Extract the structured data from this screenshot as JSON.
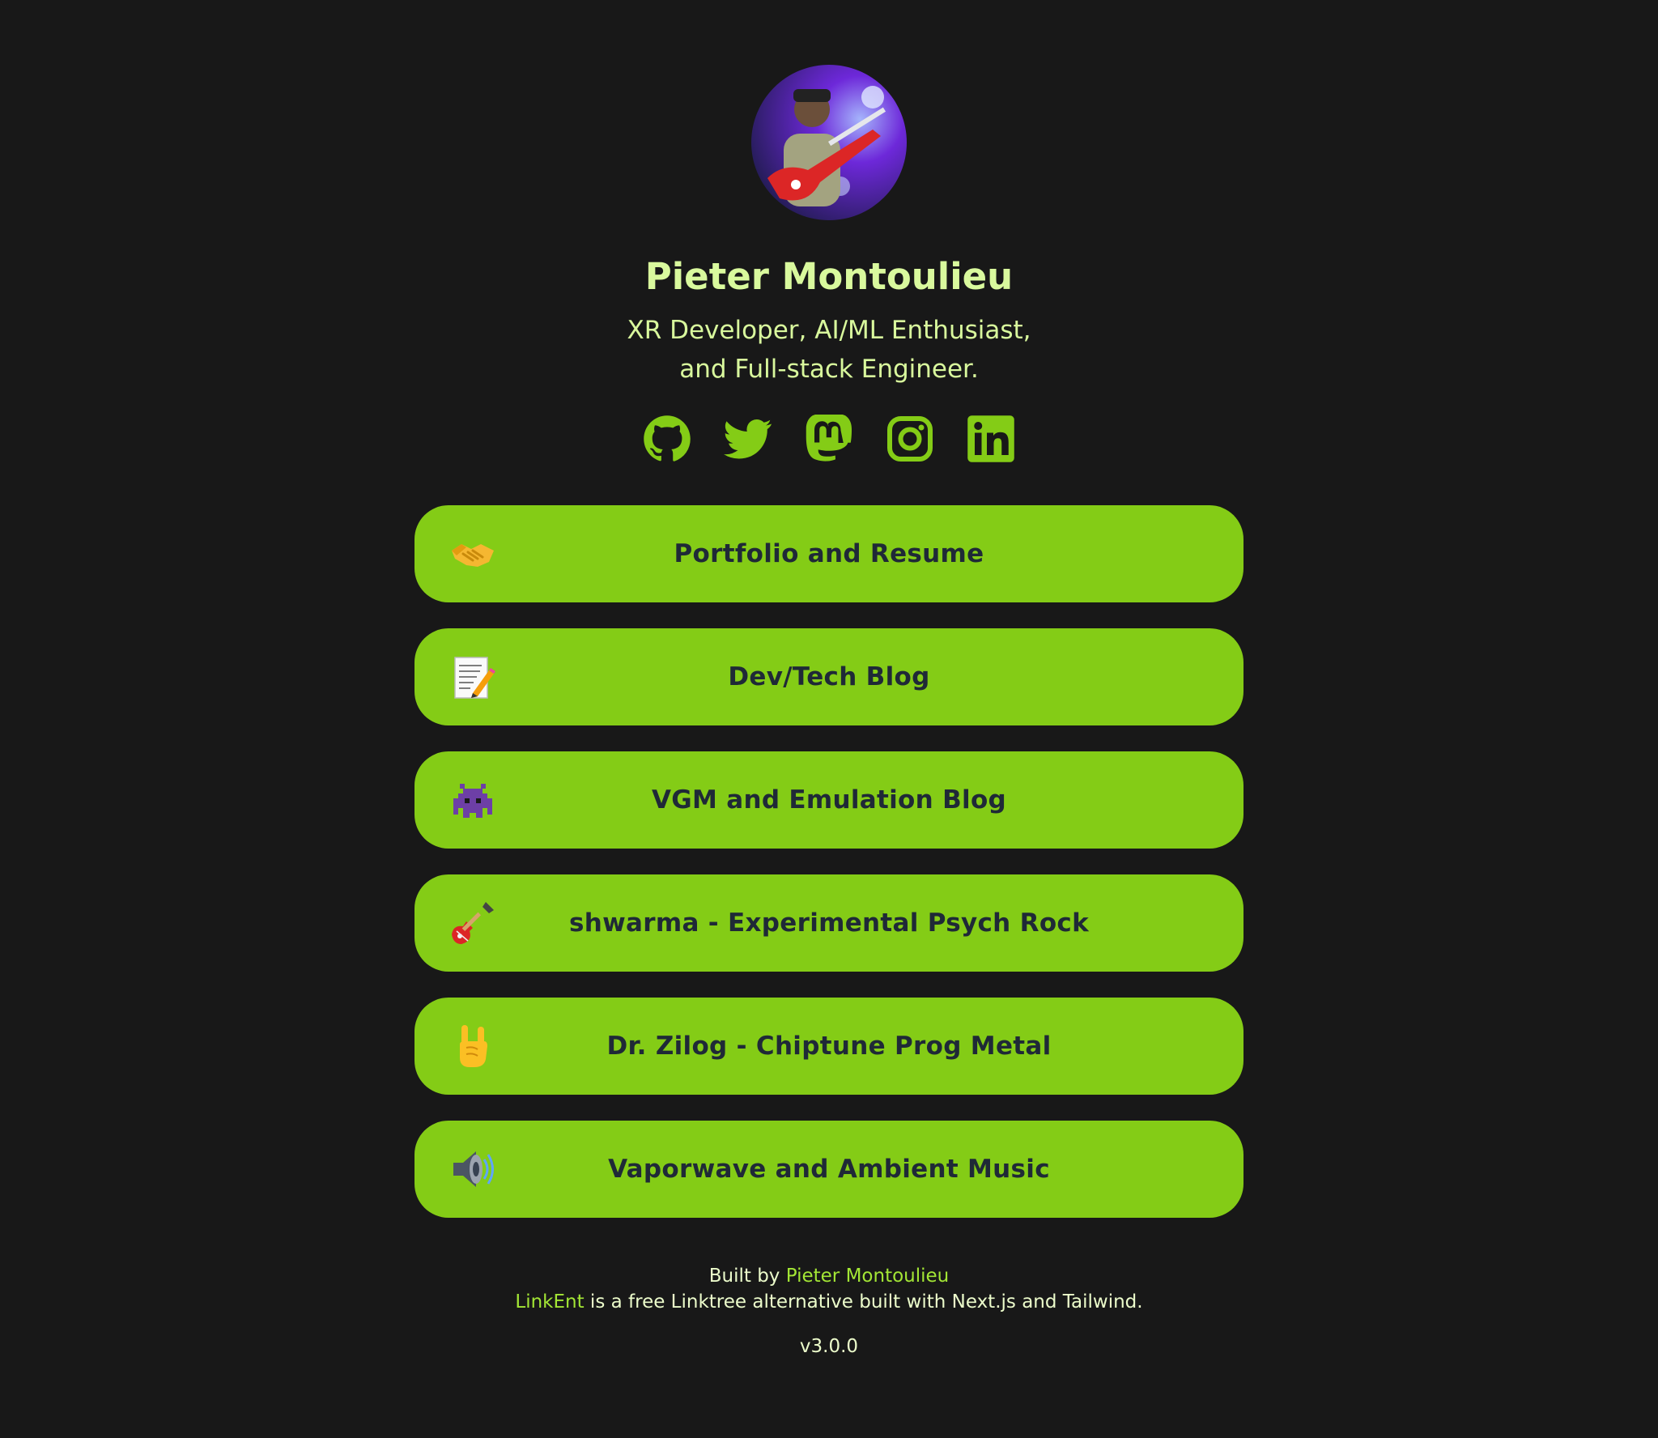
{
  "profile": {
    "name": "Pieter Montoulieu",
    "bio_line1": "XR Developer, AI/ML Enthusiast,",
    "bio_line2": "and Full-stack Engineer.",
    "avatar": "guitarist-on-stage-photo"
  },
  "socials": [
    {
      "icon": "github-icon"
    },
    {
      "icon": "twitter-icon"
    },
    {
      "icon": "mastodon-icon"
    },
    {
      "icon": "instagram-icon"
    },
    {
      "icon": "linkedin-icon"
    }
  ],
  "links": [
    {
      "label": "Portfolio and Resume",
      "icon": "handshake-emoji"
    },
    {
      "label": "Dev/Tech Blog",
      "icon": "memo-emoji"
    },
    {
      "label": "VGM and Emulation Blog",
      "icon": "space-invader-emoji"
    },
    {
      "label": "shwarma - Experimental Psych Rock",
      "icon": "guitar-emoji"
    },
    {
      "label": "Dr. Zilog - Chiptune Prog Metal",
      "icon": "rock-hand-emoji"
    },
    {
      "label": "Vaporwave and Ambient Music",
      "icon": "speaker-emoji"
    }
  ],
  "footer": {
    "built_by_prefix": "Built by ",
    "built_by_link": "Pieter Montoulieu",
    "linkent_link": "LinkEnt",
    "linkent_text": " is a free Linktree alternative built with Next.js and Tailwind.",
    "version": "v3.0.0"
  },
  "colors": {
    "background": "#181818",
    "accent": "#84cc16",
    "text": "#d9f99d",
    "link_text": "#1f2937"
  }
}
